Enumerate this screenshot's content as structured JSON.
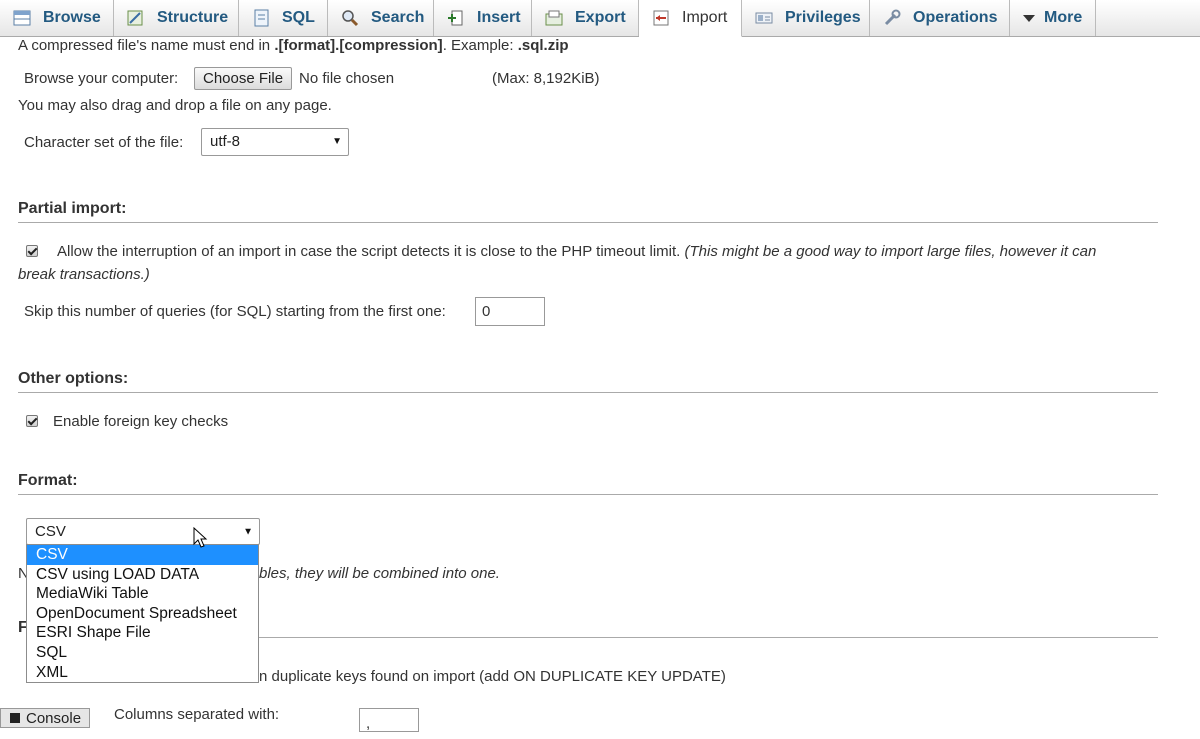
{
  "tabs": [
    {
      "label": "Browse",
      "icon": "browse-icon"
    },
    {
      "label": "Structure",
      "icon": "structure-icon"
    },
    {
      "label": "SQL",
      "icon": "sql-icon"
    },
    {
      "label": "Search",
      "icon": "search-icon"
    },
    {
      "label": "Insert",
      "icon": "insert-icon"
    },
    {
      "label": "Export",
      "icon": "export-icon"
    },
    {
      "label": "Import",
      "icon": "import-icon",
      "active": true
    },
    {
      "label": "Privileges",
      "icon": "privileges-icon"
    },
    {
      "label": "Operations",
      "icon": "operations-icon"
    },
    {
      "label": "More",
      "icon": "chevron-down-icon"
    }
  ],
  "file": {
    "note_prefix": "A compressed file's name must end in ",
    "note_format": ".[format].[compression]",
    "note_mid": ". Example: ",
    "note_example": ".sql.zip",
    "browse_label": "Browse your computer:",
    "choose_button": "Choose File",
    "no_file": "No file chosen",
    "max": "(Max: 8,192KiB)",
    "drag_note": "You may also drag and drop a file on any page.",
    "charset_label": "Character set of the file:",
    "charset_value": "utf-8"
  },
  "partial": {
    "title": "Partial import:",
    "allow_text": "Allow the interruption of an import in case the script detects it is close to the PHP timeout limit.",
    "allow_note_1": "(This might be a good way to import large files, however it can",
    "allow_note_2": "break transactions.)",
    "skip_label": "Skip this number of queries (for SQL) starting from the first one:",
    "skip_value": "0"
  },
  "other": {
    "title": "Other options:",
    "fk_label": "Enable foreign key checks"
  },
  "format": {
    "title": "Format:",
    "selected": "CSV",
    "options": [
      "CSV",
      "CSV using LOAD DATA",
      "MediaWiki Table",
      "OpenDocument Spreadsheet",
      "ESRI Shape File",
      "SQL",
      "XML"
    ],
    "hint_visible_start": "N",
    "hint_visible_rest": "bles, they will be combined into one.",
    "specific_initial": "F",
    "duplicate_text": "n duplicate keys found on import (add ON DUPLICATE KEY UPDATE)",
    "columns_label": "Columns separated with:",
    "columns_value": ","
  },
  "console": {
    "label": "Console"
  },
  "colors": {
    "tab_text": "#235a81",
    "selected_option": "#1e90ff"
  }
}
